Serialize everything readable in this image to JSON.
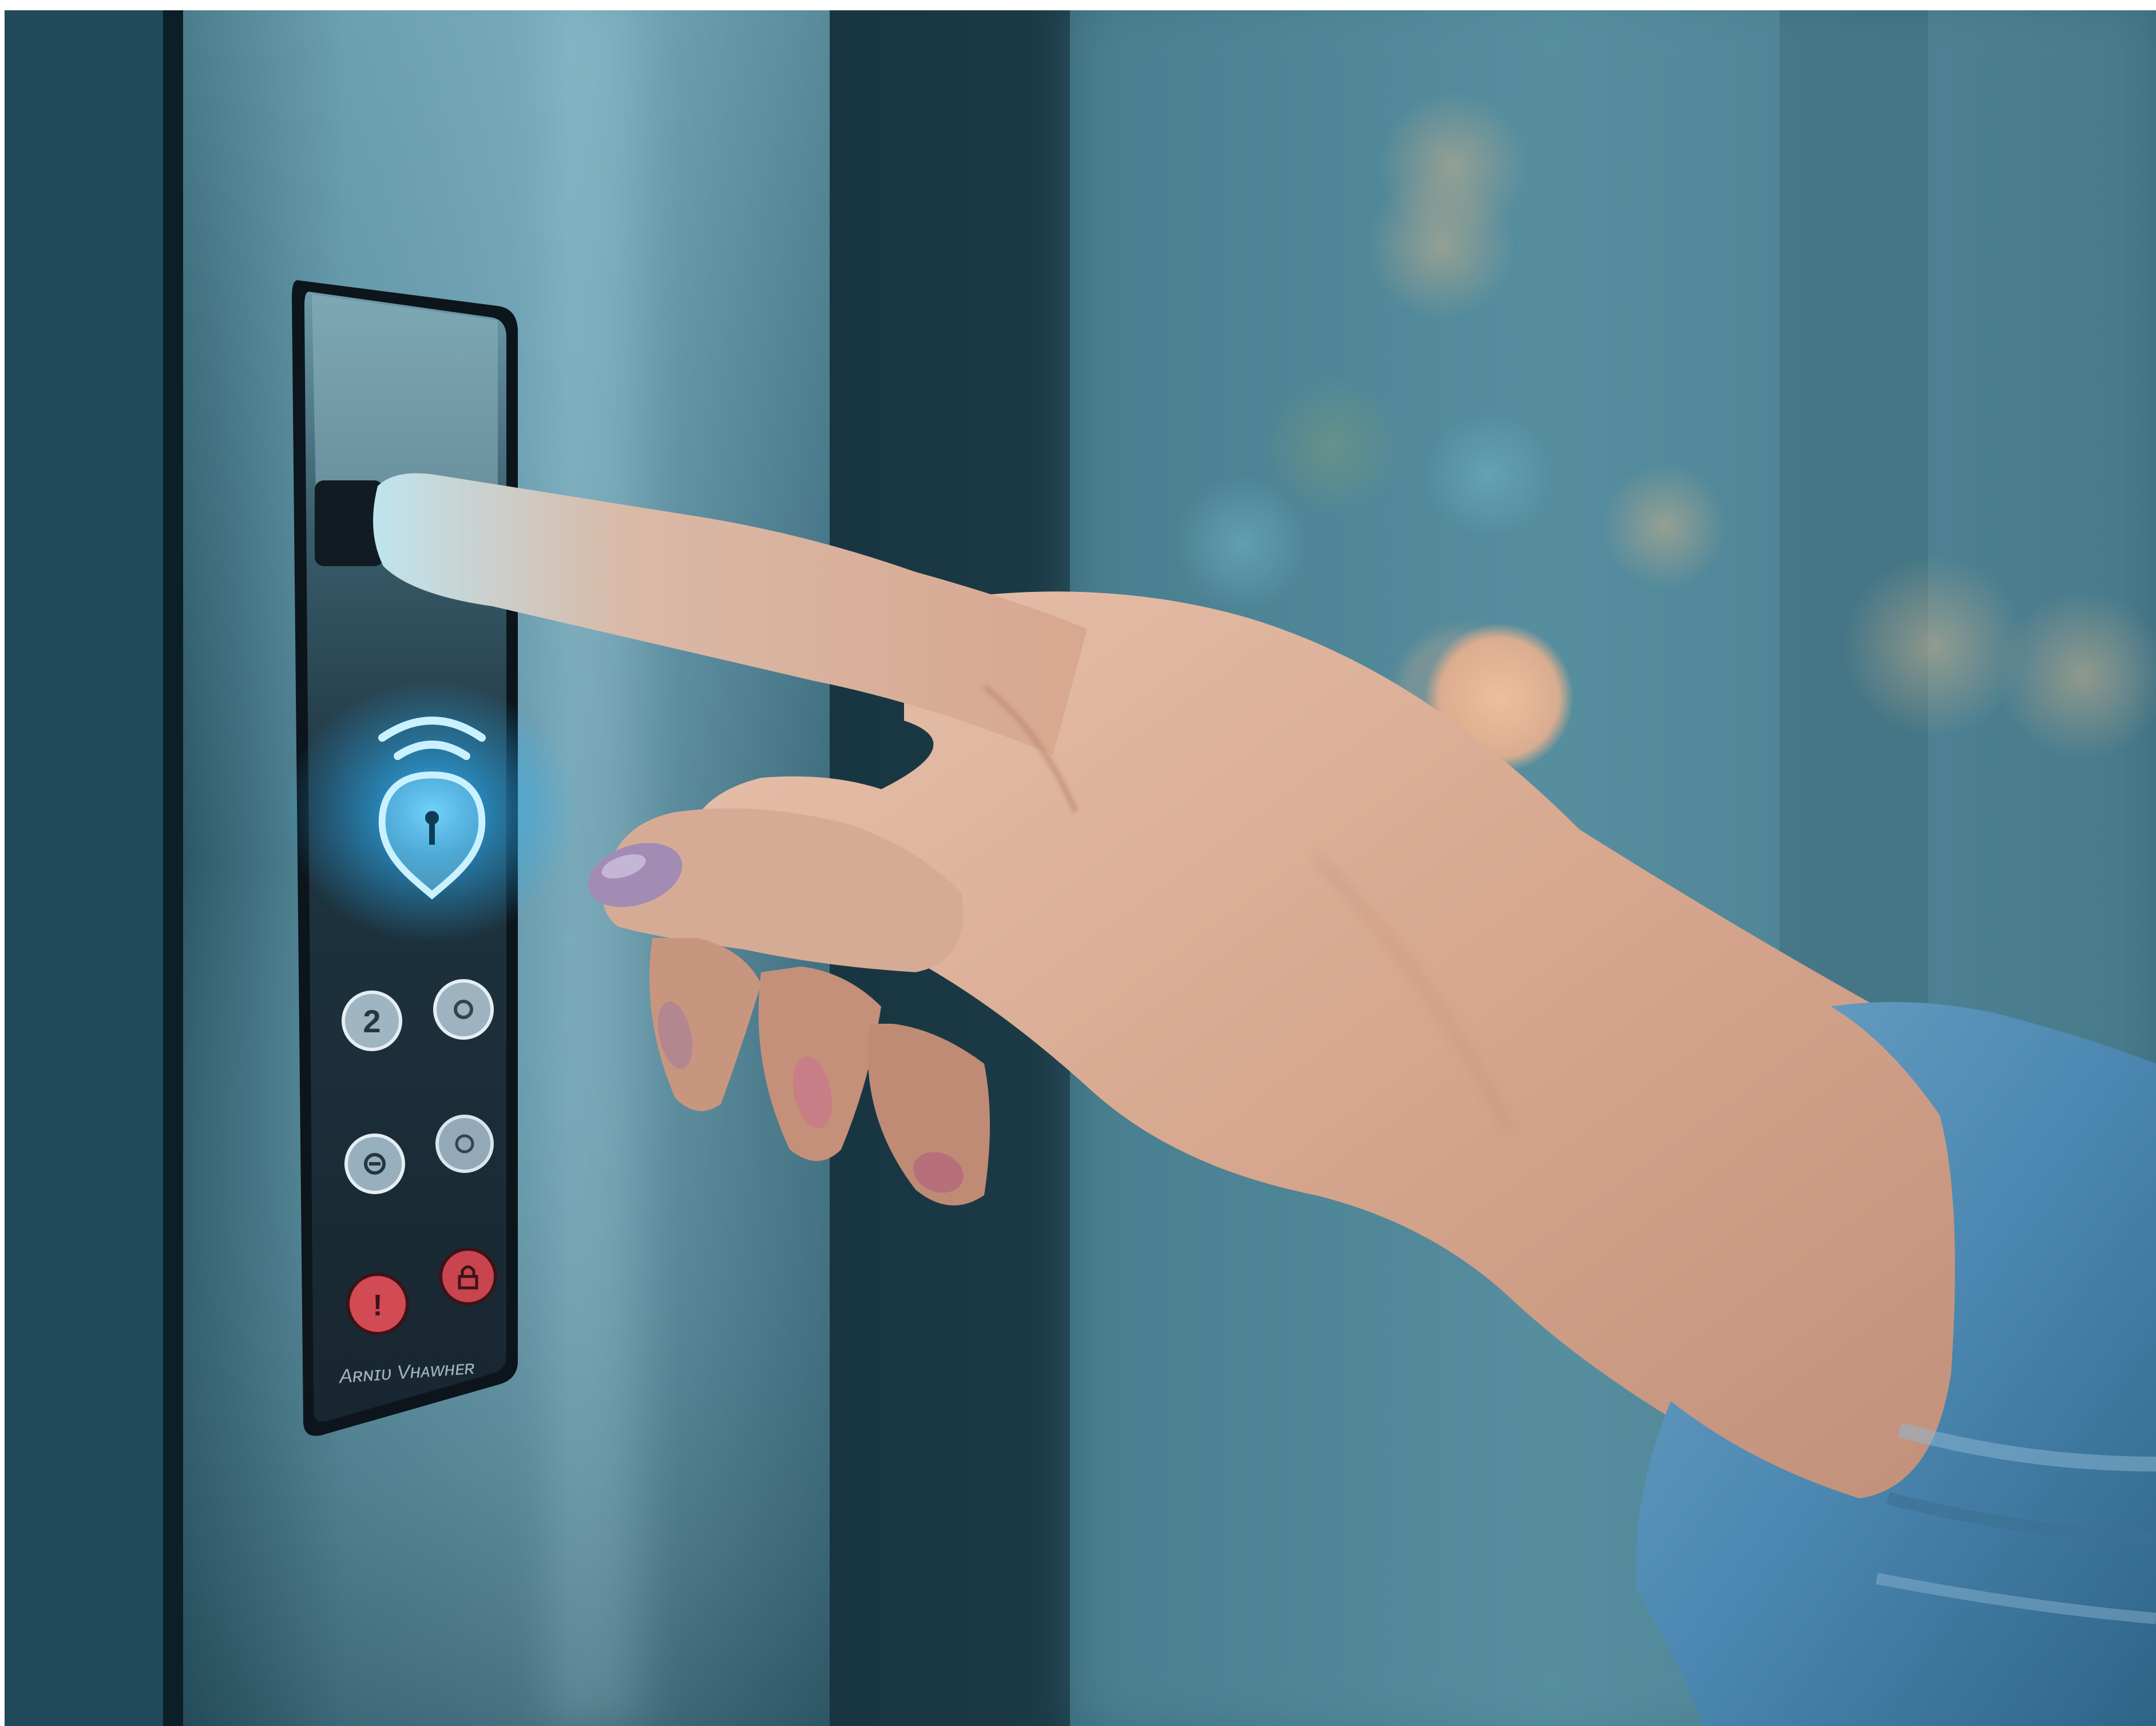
{
  "scene": {
    "description_free_note": "",
    "palette": {
      "frame_white": "#ffffff",
      "glass_teal": "#3f7285",
      "door_steel": "#4f7f90",
      "door_dark_edge": "#0f2b36",
      "panel_dark": "#1b2a33",
      "glow_blue": "#2fb6ff",
      "skin": "#d9aa93",
      "nail": "#a28cb4",
      "sleeve_blue": "#4c88b2",
      "bokeh_warm": "#e7b08e",
      "key_red": "#d24a53",
      "key_grey": "#9eb3c0"
    }
  },
  "keypad": {
    "icon": "wifi-shield-lock-icon",
    "keys": [
      {
        "label": "2",
        "icon": ""
      },
      {
        "label": "",
        "icon": "circle-key-icon"
      },
      {
        "label": "",
        "icon": "minus-circle-key-icon"
      },
      {
        "label": "",
        "icon": "circle-key-icon"
      },
      {
        "label": "!",
        "icon": ""
      },
      {
        "label": "",
        "icon": "lock-key-icon"
      }
    ],
    "footer_text": "Aʀɴɪᴜ Vʜᴀᴡʜᴇʀ"
  }
}
